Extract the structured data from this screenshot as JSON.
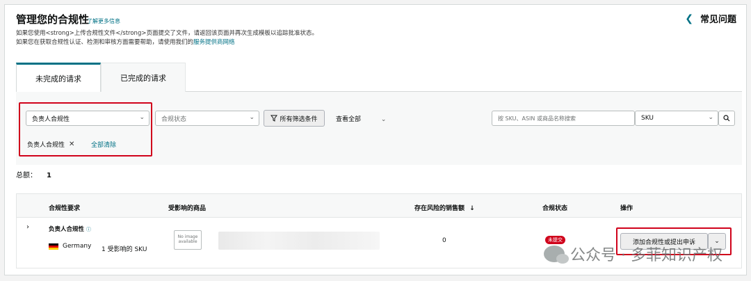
{
  "header": {
    "title": "管理您的合规性",
    "learn_more": "了解更多信息",
    "note1": "如果您使用<strong>上传合规性文件</strong>页面提交了文件，请返回该页面并再次生成模板以追踪批准状态。",
    "note2_prefix": "如果您在获取合规性认证、检测和审核方面需要帮助，请使用我们的",
    "note2_link": "服务提供商网络",
    "faq_label": "常见问题",
    "faq_chevron": "chevron-left-icon"
  },
  "tabs": [
    {
      "label": "未完成的请求",
      "active": true
    },
    {
      "label": "已完成的请求",
      "active": false
    }
  ],
  "filters": {
    "responsible_select": "负责人合规性",
    "status_placeholder": "合规状态",
    "all_filters_label": "所有筛选条件",
    "view_all_label": "查看全部",
    "search_placeholder": "按 SKU、ASIN 或商品名称搜索",
    "search_scope": "SKU",
    "active_chip": "负责人合规性",
    "clear_all": "全部清除"
  },
  "summary": {
    "total_label": "总额：",
    "total_value": "1"
  },
  "table": {
    "columns": [
      "合规性要求",
      "受影响的商品",
      "存在风险的销售额",
      "合规状态",
      "操作"
    ],
    "sort_icon": "arrow-down-icon",
    "rows": [
      {
        "requirement": "负责人合规性",
        "country": "Germany",
        "affected": "1 受影响的 SKU",
        "no_image_text": "No image available",
        "sales_at_risk": "0",
        "status": "未提交",
        "action": "添加合规性或提出申诉"
      }
    ]
  },
  "watermark": {
    "text": "公众号 · 多菲知识产权"
  },
  "colors": {
    "link": "#007185",
    "highlight_box": "#d0021b",
    "status_badge": "#d0021b"
  }
}
